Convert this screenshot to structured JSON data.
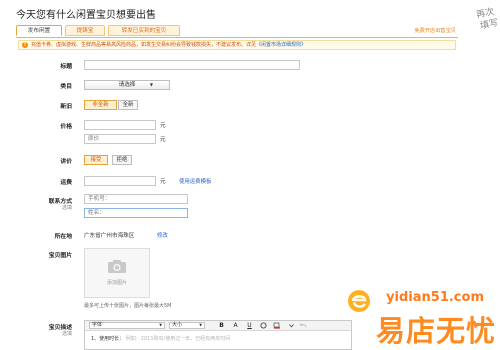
{
  "header": {
    "title": "今天您有什么闲置宝贝想要出售"
  },
  "decoration": {
    "line1": "再次",
    "line2": "填写"
  },
  "tabs": [
    {
      "label": "发布闲置"
    },
    {
      "label": "提铸宝"
    },
    {
      "label": "转发已买到的宝贝"
    }
  ],
  "tab_link": "免费开店出售宝贝",
  "notice": {
    "text": "充值卡券、虚拟游戏、生鲜商品等易高风险商品，如发生交易纠纷会导致钱款损失，不建议发布。详见",
    "link": "《闲置市场详细规则》"
  },
  "form": {
    "title": {
      "label": "标题",
      "value": ""
    },
    "category": {
      "label": "类目",
      "selected": "请选择"
    },
    "condition": {
      "label": "新旧",
      "options": [
        "非全新",
        "全新"
      ],
      "selected_index": 0
    },
    "price": {
      "label": "价格",
      "value": "",
      "unit": "元",
      "original_placeholder": "原价",
      "original_unit": "元"
    },
    "bargain": {
      "label": "讲价",
      "options": [
        "接受",
        "拒绝"
      ],
      "selected_index": 0
    },
    "shipping": {
      "label": "运费",
      "value": "",
      "unit": "元",
      "template_link": "使用运费模板"
    },
    "contact": {
      "label": "联系方式",
      "sublabel": "选填",
      "phone_placeholder": "手机号：",
      "name_placeholder": "姓名："
    },
    "location": {
      "label": "所在地",
      "value": "广东省广州市海珠区",
      "edit_link": "修改"
    },
    "photos": {
      "label": "宝贝图片",
      "upload_text": "添加图片",
      "hint": "最多可上传十张图片，图片每张最大5M"
    },
    "description": {
      "label": "宝贝描述",
      "sublabel": "选填",
      "font_label": "字体",
      "size_label": "大小",
      "first_line": "1、使用时长：",
      "first_line_hint": "例如：2011购买/使用过一年，已经有两年时间"
    }
  },
  "editor_buttons": [
    "B",
    "A",
    "U"
  ],
  "watermark": {
    "url": "yidian51.com",
    "name": "易店无忧"
  }
}
